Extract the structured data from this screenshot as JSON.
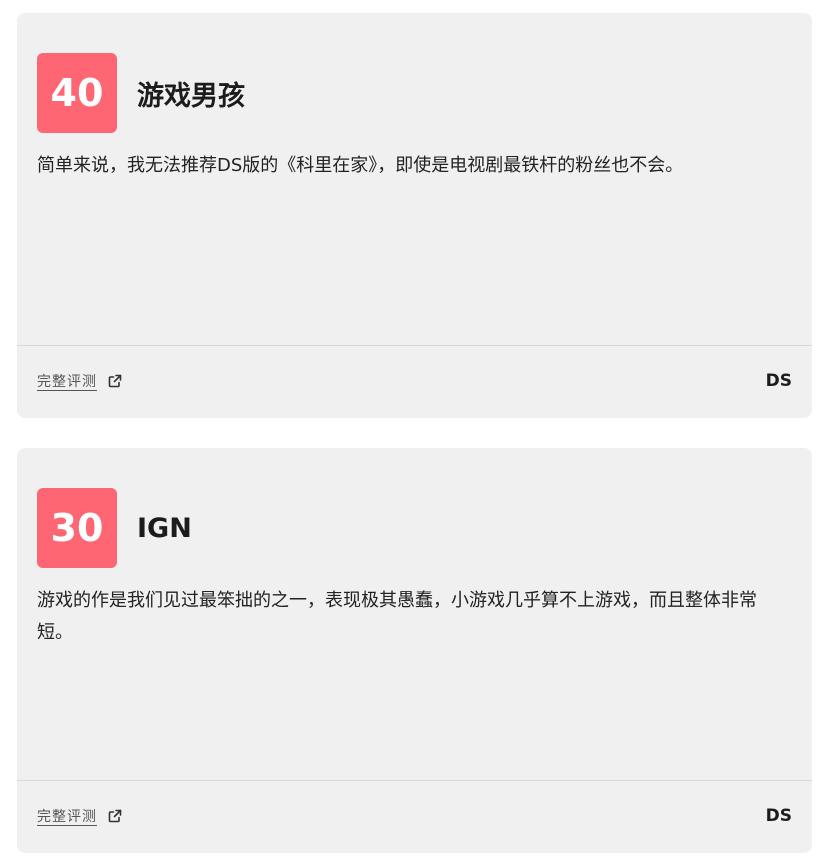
{
  "colors": {
    "card_background": "#f0f0f0",
    "score_background": "#ff6673",
    "score_text": "#ffffff"
  },
  "reviews": [
    {
      "score": "40",
      "outlet": "游戏男孩",
      "quote": "简单来说，我无法推荐DS版的《科里在家》，即使是电视剧最铁杆的粉丝也不会。",
      "link_label": "完整评测",
      "link_icon": "external-link-icon",
      "platform": "DS"
    },
    {
      "score": "30",
      "outlet": "IGN",
      "quote": "游戏的作是我们见过最笨拙的之一，表现极其愚蠢，小游戏几乎算不上游戏，而且整体非常短。",
      "link_label": "完整评测",
      "link_icon": "external-link-icon",
      "platform": "DS"
    }
  ]
}
